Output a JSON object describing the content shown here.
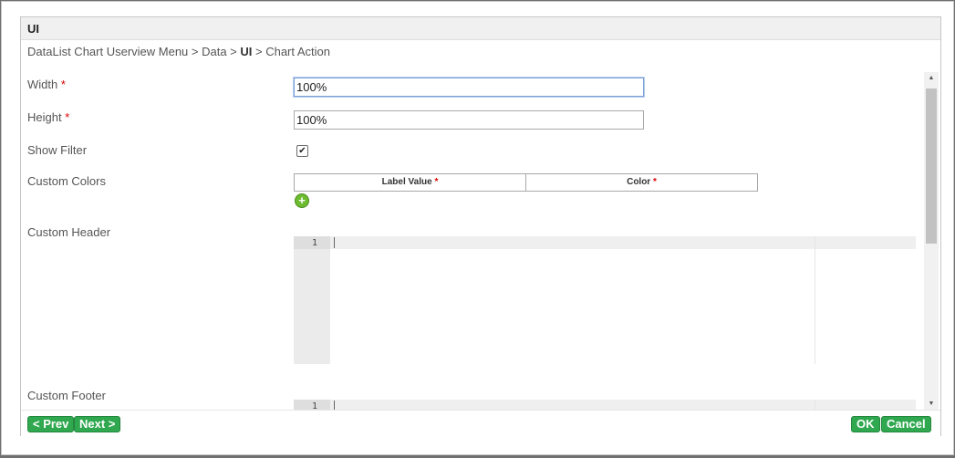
{
  "dialog": {
    "title": "UI",
    "breadcrumb": {
      "prefix": "DataList Chart Userview Menu > Data > ",
      "current": "UI",
      "suffix": " > Chart Action"
    }
  },
  "form": {
    "width": {
      "label": "Width",
      "required": "*",
      "value": "100%"
    },
    "height": {
      "label": "Height",
      "required": "*",
      "value": "100%"
    },
    "show_filter": {
      "label": "Show Filter",
      "checked": true,
      "check_glyph": "✔"
    },
    "custom_colors": {
      "label": "Custom Colors",
      "columns": [
        {
          "label": "Label Value",
          "required": "*"
        },
        {
          "label": "Color",
          "required": "*"
        }
      ],
      "add_icon": "plus-circle-icon",
      "add_glyph": "+"
    },
    "custom_header": {
      "label": "Custom Header",
      "line_number": "1"
    },
    "custom_footer": {
      "label": "Custom Footer",
      "line_number": "1"
    }
  },
  "footer": {
    "prev_label": "< Prev",
    "next_label": "Next >",
    "ok_label": "OK",
    "cancel_label": "Cancel"
  },
  "colors": {
    "button_green": "#2fa84f",
    "add_icon_green": "#6dbb2f",
    "required_red": "#d00000"
  }
}
